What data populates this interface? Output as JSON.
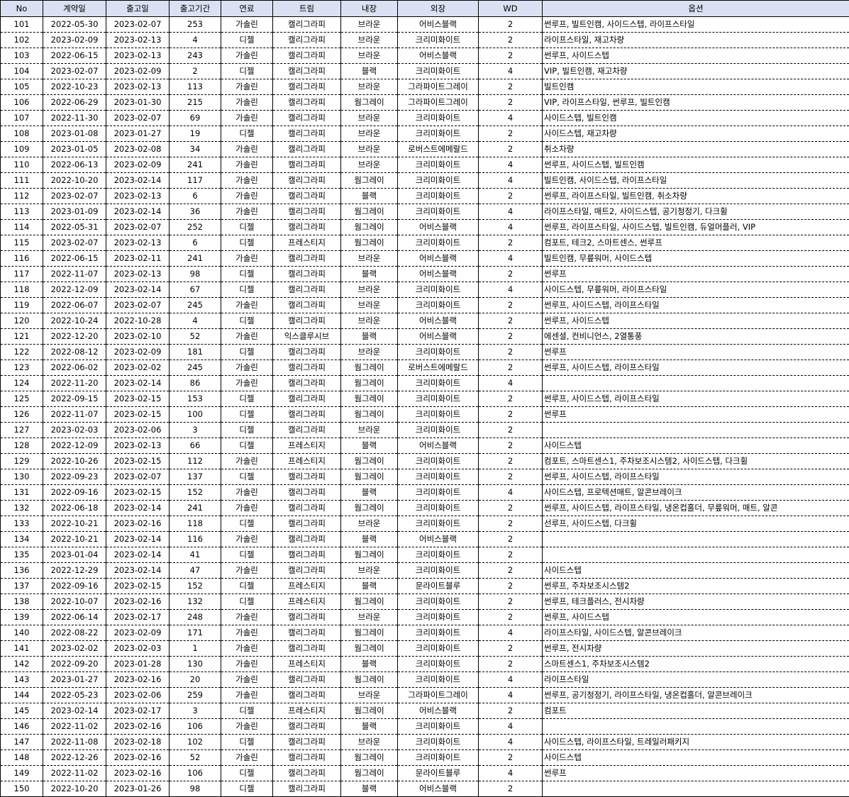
{
  "headers": [
    "No",
    "계약일",
    "출고일",
    "출고기간",
    "연료",
    "트림",
    "내장",
    "외장",
    "WD",
    "옵션"
  ],
  "rows": [
    [
      "101",
      "2022-05-30",
      "2023-02-07",
      "253",
      "가솔린",
      "캘리그라피",
      "브라운",
      "어비스블랙",
      "2",
      "썬루프, 빌트인캠, 사이드스텝, 라이프스타일"
    ],
    [
      "102",
      "2023-02-09",
      "2023-02-13",
      "4",
      "디젤",
      "캘리그라피",
      "브라운",
      "크리미화이트",
      "2",
      "라이프스타일, 재고차량"
    ],
    [
      "103",
      "2022-06-15",
      "2023-02-13",
      "243",
      "가솔린",
      "캘리그라피",
      "브라운",
      "어비스블랙",
      "2",
      "썬루프, 사이드스텝"
    ],
    [
      "104",
      "2023-02-07",
      "2023-02-09",
      "2",
      "디젤",
      "캘리그라피",
      "블랙",
      "크리미화이트",
      "4",
      "VIP, 빌트인캠, 재고차량"
    ],
    [
      "105",
      "2022-10-23",
      "2023-02-13",
      "113",
      "가솔린",
      "캘리그라피",
      "브라운",
      "그라파이트그레이",
      "2",
      "빌트인캠"
    ],
    [
      "106",
      "2022-06-29",
      "2023-01-30",
      "215",
      "가솔린",
      "캘리그라피",
      "웜그레이",
      "그라파이트그레이",
      "2",
      "VIP, 라이프스타일, 썬루프, 빌트인캠"
    ],
    [
      "107",
      "2022-11-30",
      "2023-02-07",
      "69",
      "가솔린",
      "캘리그라피",
      "브라운",
      "크리미화이트",
      "4",
      "사이드스텝, 빌트인캠"
    ],
    [
      "108",
      "2023-01-08",
      "2023-01-27",
      "19",
      "디젤",
      "캘리그라피",
      "브라운",
      "크리미화이트",
      "2",
      "사이드스텝, 재고차량"
    ],
    [
      "109",
      "2023-01-05",
      "2023-02-08",
      "34",
      "가솔린",
      "캘리그라피",
      "브라운",
      "로버스트에메랄드",
      "2",
      "취소차량"
    ],
    [
      "110",
      "2022-06-13",
      "2023-02-09",
      "241",
      "가솔린",
      "캘리그라피",
      "브라운",
      "크리미화이트",
      "4",
      "썬루프, 사이드스텝, 빌트인캠"
    ],
    [
      "111",
      "2022-10-20",
      "2023-02-14",
      "117",
      "가솔린",
      "캘리그라피",
      "웜그레이",
      "크리미화이트",
      "4",
      "빌트인캠, 사이드스텝, 라이프스타일"
    ],
    [
      "112",
      "2023-02-07",
      "2023-02-13",
      "6",
      "가솔린",
      "캘리그라피",
      "블랙",
      "크리미화이트",
      "2",
      "썬루프, 라이프스타일, 빌트인캠, 취소차량"
    ],
    [
      "113",
      "2023-01-09",
      "2023-02-14",
      "36",
      "가솔린",
      "캘리그라피",
      "웜그레이",
      "크리미화이트",
      "4",
      "라이프스타일, 매트2, 사이드스텝, 공기청정기, 다크휠"
    ],
    [
      "114",
      "2022-05-31",
      "2023-02-07",
      "252",
      "디젤",
      "캘리그라피",
      "웜그레이",
      "어비스블랙",
      "4",
      "썬루프, 라이프스타일, 사이드스텝, 빌트인캠, 듀얼머플러, VIP"
    ],
    [
      "115",
      "2023-02-07",
      "2023-02-13",
      "6",
      "디젤",
      "프레스티지",
      "웜그레이",
      "크리미화이트",
      "2",
      "컴포트, 테크2, 스마트센스, 썬루프"
    ],
    [
      "116",
      "2022-06-15",
      "2023-02-11",
      "241",
      "가솔린",
      "캘리그라피",
      "브라운",
      "어비스블랙",
      "4",
      "빌트인캠, 무릎워머, 사이드스텝"
    ],
    [
      "117",
      "2022-11-07",
      "2023-02-13",
      "98",
      "디젤",
      "캘리그라피",
      "블랙",
      "어비스블랙",
      "2",
      "썬루프"
    ],
    [
      "118",
      "2022-12-09",
      "2023-02-14",
      "67",
      "디젤",
      "캘리그라피",
      "브라운",
      "크리미화이트",
      "4",
      "사이드스텝, 무릎워머, 라이프스타일"
    ],
    [
      "119",
      "2022-06-07",
      "2023-02-07",
      "245",
      "가솔린",
      "캘리그라피",
      "브라운",
      "크리미화이트",
      "2",
      "썬루프, 사이드스텝, 라이프스타일"
    ],
    [
      "120",
      "2022-10-24",
      "2022-10-28",
      "4",
      "디젤",
      "캘리그라피",
      "브라운",
      "어비스블랙",
      "2",
      "썬루프, 사이드스텝"
    ],
    [
      "121",
      "2022-12-20",
      "2023-02-10",
      "52",
      "가솔린",
      "익스클루시브",
      "블랙",
      "어비스블랙",
      "2",
      "에센셜, 컨비니언스, 2열통풍"
    ],
    [
      "122",
      "2022-08-12",
      "2023-02-09",
      "181",
      "디젤",
      "캘리그라피",
      "브라운",
      "크리미화이트",
      "2",
      "썬루프"
    ],
    [
      "123",
      "2022-06-02",
      "2023-02-02",
      "245",
      "가솔린",
      "캘리그라피",
      "웜그레이",
      "로버스트에메랄드",
      "2",
      "썬루프, 사이드스텝, 라이프스타일"
    ],
    [
      "124",
      "2022-11-20",
      "2023-02-14",
      "86",
      "가솔린",
      "캘리그라피",
      "웜그레이",
      "크리미화이트",
      "4",
      ""
    ],
    [
      "125",
      "2022-09-15",
      "2023-02-15",
      "153",
      "디젤",
      "캘리그라피",
      "웜그레이",
      "크리미화이트",
      "2",
      "썬루프, 사이드스텝, 라이프스타일"
    ],
    [
      "126",
      "2022-11-07",
      "2023-02-15",
      "100",
      "디젤",
      "캘리그라피",
      "웜그레이",
      "크리미화이트",
      "2",
      "썬루프"
    ],
    [
      "127",
      "2023-02-03",
      "2023-02-06",
      "3",
      "디젤",
      "캘리그라피",
      "브라운",
      "크리미화이트",
      "2",
      ""
    ],
    [
      "128",
      "2022-12-09",
      "2023-02-13",
      "66",
      "디젤",
      "프레스티지",
      "블랙",
      "어비스블랙",
      "2",
      "사이드스텝"
    ],
    [
      "129",
      "2022-10-26",
      "2023-02-15",
      "112",
      "가솔린",
      "프레스티지",
      "웜그레이",
      "크리미화이트",
      "2",
      "컴포트, 스마트센스1, 주차보조시스템2, 사이드스텝, 다크휠"
    ],
    [
      "130",
      "2022-09-23",
      "2023-02-07",
      "137",
      "디젤",
      "캘리그라피",
      "웜그레이",
      "크리미화이트",
      "2",
      "썬루프, 사이드스텝, 라이프스타일"
    ],
    [
      "131",
      "2022-09-16",
      "2023-02-15",
      "152",
      "가솔린",
      "캘리그라피",
      "블랙",
      "크리미화이트",
      "4",
      "사이드스텝, 프로텍션매트, 알콘브레이크"
    ],
    [
      "132",
      "2022-06-18",
      "2023-02-14",
      "241",
      "가솔린",
      "캘리그라피",
      "웜그레이",
      "크리미화이트",
      "2",
      "썬루프, 사이드스텝, 라이프스타일, 냉온컵홀더, 무릎워머, 매트, 알콘"
    ],
    [
      "133",
      "2022-10-21",
      "2023-02-16",
      "118",
      "디젤",
      "캘리그라피",
      "브라운",
      "크리미화이트",
      "2",
      "선루프, 사이드스텝, 다크휠"
    ],
    [
      "134",
      "2022-10-21",
      "2023-02-14",
      "116",
      "가솔린",
      "캘리그라피",
      "블랙",
      "어비스블랙",
      "2",
      ""
    ],
    [
      "135",
      "2023-01-04",
      "2023-02-14",
      "41",
      "디젤",
      "캘리그라피",
      "웜그레이",
      "크리미화이트",
      "2",
      ""
    ],
    [
      "136",
      "2022-12-29",
      "2023-02-14",
      "47",
      "가솔린",
      "캘리그라피",
      "브라운",
      "크리미화이트",
      "2",
      "사이드스텝"
    ],
    [
      "137",
      "2022-09-16",
      "2023-02-15",
      "152",
      "디젤",
      "프레스티지",
      "블랙",
      "문라이트블루",
      "2",
      "썬루프, 주차보조시스템2"
    ],
    [
      "138",
      "2022-10-07",
      "2023-02-16",
      "132",
      "디젤",
      "프레스티지",
      "웜그레이",
      "크리미화이트",
      "2",
      "썬루프, 테크플러스, 전시차량"
    ],
    [
      "139",
      "2022-06-14",
      "2023-02-17",
      "248",
      "가솔린",
      "캘리그라피",
      "브라운",
      "크리미화이트",
      "2",
      "썬루프, 사이드스텝"
    ],
    [
      "140",
      "2022-08-22",
      "2023-02-09",
      "171",
      "가솔린",
      "캘리그라피",
      "웜그레이",
      "크리미화이트",
      "4",
      "라이프스타일, 사이드스텝, 알콘브레이크"
    ],
    [
      "141",
      "2023-02-02",
      "2023-02-03",
      "1",
      "가솔린",
      "캘리그라피",
      "웜그레이",
      "크리미화이트",
      "2",
      "썬루프, 전시차량"
    ],
    [
      "142",
      "2022-09-20",
      "2023-01-28",
      "130",
      "가솔린",
      "프레스티지",
      "블랙",
      "크리미화이트",
      "2",
      "스마트센스1, 주차보조시스템2"
    ],
    [
      "143",
      "2023-01-27",
      "2023-02-16",
      "20",
      "가솔린",
      "캘리그라피",
      "웜그레이",
      "크리미화이트",
      "4",
      "라이프스타일"
    ],
    [
      "144",
      "2022-05-23",
      "2023-02-06",
      "259",
      "가솔린",
      "캘리그라피",
      "브라운",
      "그라파이트그레이",
      "4",
      "썬루프, 공기청정기, 라이프스타일, 냉온컵홀더, 알콘브레이크"
    ],
    [
      "145",
      "2023-02-14",
      "2023-02-17",
      "3",
      "디젤",
      "프레스티지",
      "웜그레이",
      "어비스블랙",
      "2",
      "컴포트"
    ],
    [
      "146",
      "2022-11-02",
      "2023-02-16",
      "106",
      "가솔린",
      "캘리그라피",
      "블랙",
      "크리미화이트",
      "4",
      ""
    ],
    [
      "147",
      "2022-11-08",
      "2023-02-18",
      "102",
      "디젤",
      "캘리그라피",
      "브라운",
      "크리미화이트",
      "4",
      "사이드스텝, 라이프스타일, 트레일러패키지"
    ],
    [
      "148",
      "2022-12-26",
      "2023-02-16",
      "52",
      "가솔린",
      "캘리그라피",
      "웜그레이",
      "크리미화이트",
      "2",
      "사이드스텝"
    ],
    [
      "149",
      "2022-11-02",
      "2023-02-16",
      "106",
      "디젤",
      "캘리그라피",
      "웜그레이",
      "문라이트블루",
      "4",
      "썬루프"
    ],
    [
      "150",
      "2022-10-20",
      "2023-01-26",
      "98",
      "디젤",
      "캘리그라피",
      "블랙",
      "어비스블랙",
      "2",
      ""
    ]
  ]
}
